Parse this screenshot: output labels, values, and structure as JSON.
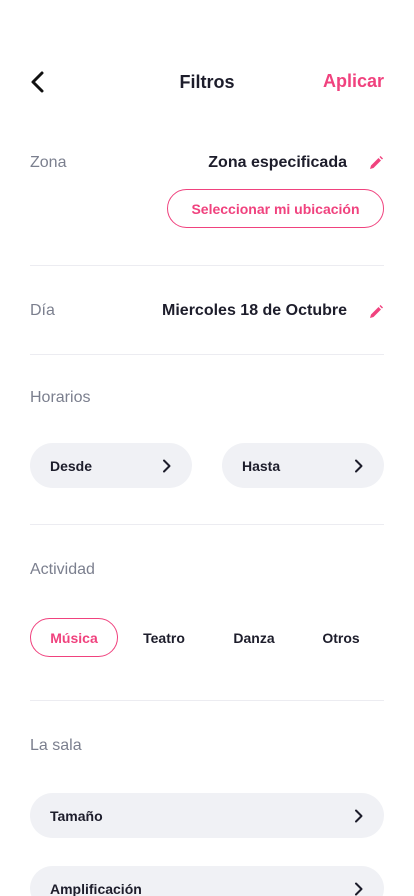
{
  "header": {
    "title": "Filtros",
    "apply_label": "Aplicar"
  },
  "zona": {
    "label": "Zona",
    "value": "Zona especificada",
    "location_button": "Seleccionar mi ubicación"
  },
  "dia": {
    "label": "Día",
    "value": "Miercoles 18 de Octubre"
  },
  "horarios": {
    "label": "Horarios",
    "desde": "Desde",
    "hasta": "Hasta"
  },
  "actividad": {
    "label": "Actividad",
    "options": [
      {
        "label": "Música",
        "selected": true
      },
      {
        "label": "Teatro",
        "selected": false
      },
      {
        "label": "Danza",
        "selected": false
      },
      {
        "label": "Otros",
        "selected": false
      }
    ]
  },
  "sala": {
    "label": "La sala",
    "items": [
      {
        "label": "Tamaño"
      },
      {
        "label": "Amplificación"
      }
    ]
  },
  "colors": {
    "accent": "#f0427e",
    "pill_bg": "#f0f1f5",
    "label_gray": "#7b7f8e",
    "text_dark": "#1d1d2b"
  },
  "icons": {
    "back": "chevron-left-icon",
    "edit": "pencil-icon",
    "chevron": "chevron-right-icon"
  }
}
